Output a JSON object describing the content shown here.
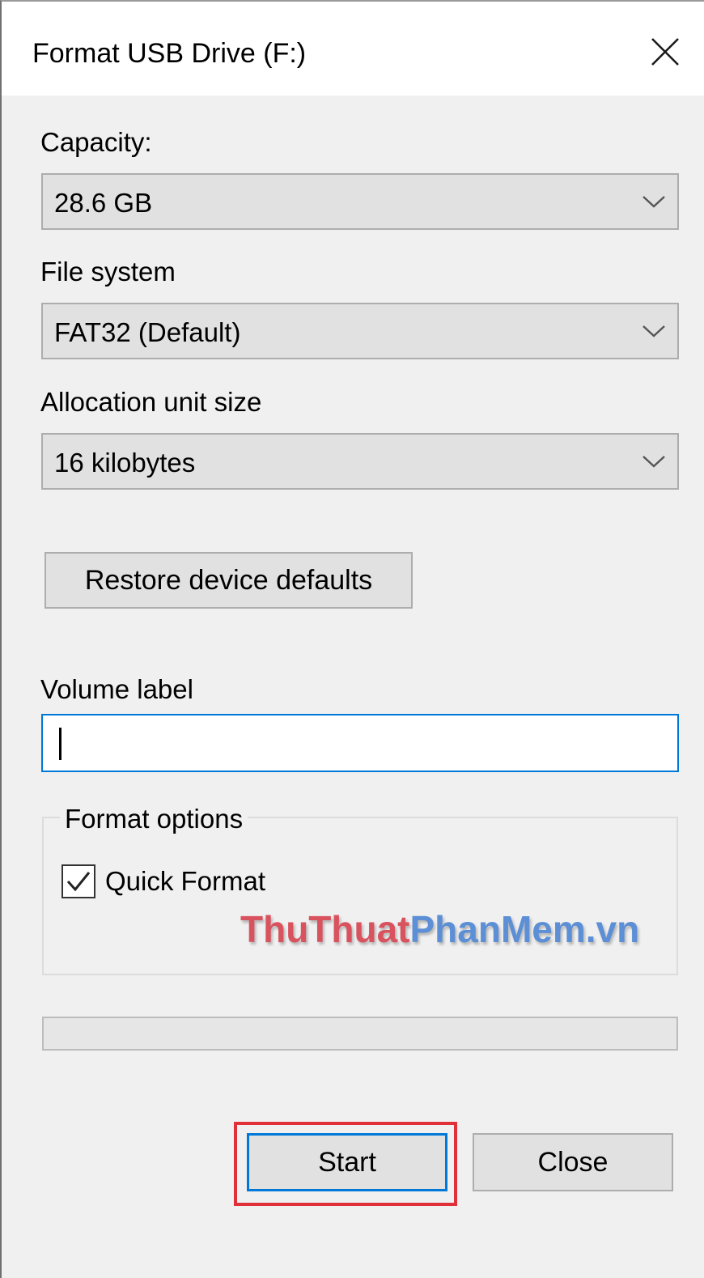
{
  "window": {
    "title": "Format USB Drive (F:)"
  },
  "capacity": {
    "label": "Capacity:",
    "value": "28.6 GB"
  },
  "file_system": {
    "label": "File system",
    "value": "FAT32 (Default)"
  },
  "allocation": {
    "label": "Allocation unit size",
    "value": "16 kilobytes"
  },
  "restore_button": {
    "label": "Restore device defaults"
  },
  "volume": {
    "label": "Volume label",
    "value": ""
  },
  "format_options": {
    "legend": "Format options",
    "quick_format_label": "Quick Format",
    "quick_format_checked": true
  },
  "watermark": {
    "part1": "ThuThuat",
    "part2": "PhanMem.vn"
  },
  "progress": {
    "fraction": 0
  },
  "buttons": {
    "start_label": "Start",
    "close_label": "Close"
  },
  "icons": {
    "close": "close-icon",
    "dropdown": "chevron-down-icon",
    "check": "checkmark-icon"
  },
  "colors": {
    "focus_blue": "#0078d7",
    "highlight_red": "#e0303a",
    "button_face": "#e1e1e1",
    "dialog_bg": "#f0f0f0"
  }
}
